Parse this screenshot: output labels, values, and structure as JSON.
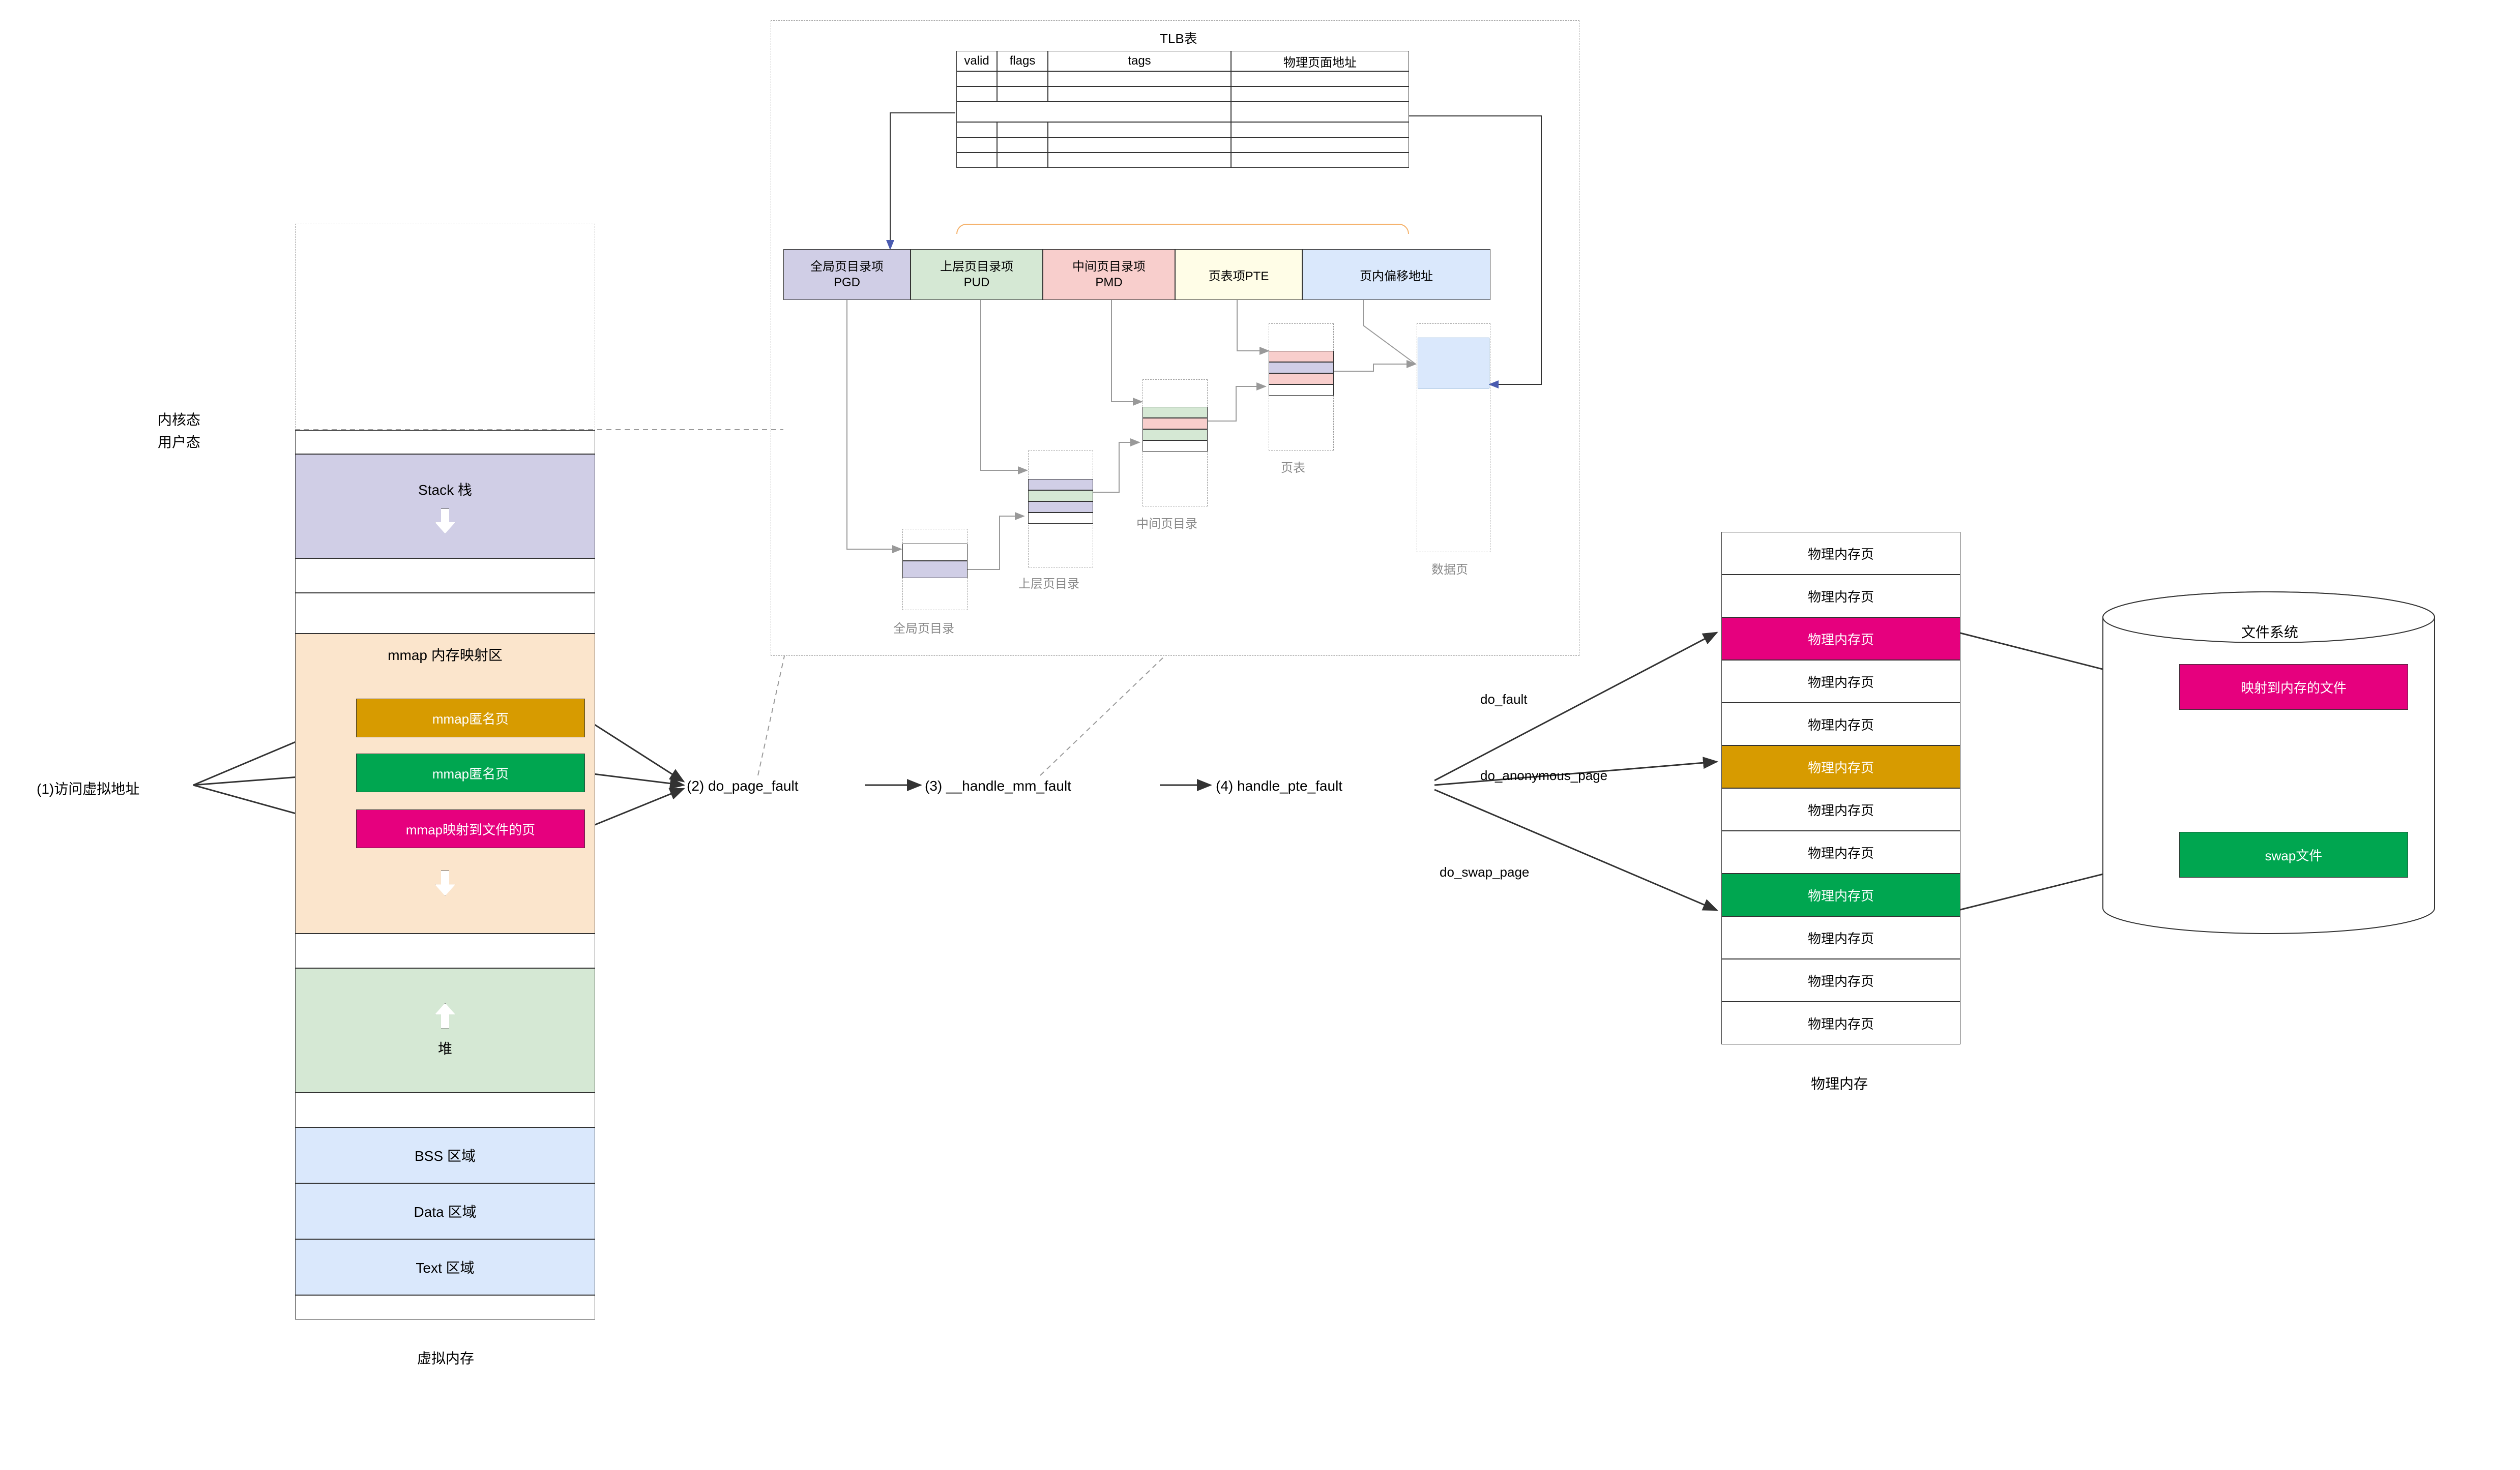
{
  "left": {
    "kernel_label": "内核态",
    "user_label": "用户态",
    "access_label": "(1)访问虚拟地址",
    "stack_label": "Stack 栈",
    "mmap_section": "mmap 内存映射区",
    "mmap_anon1": "mmap匿名页",
    "mmap_anon2": "mmap匿名页",
    "mmap_file": "mmap映射到文件的页",
    "heap_label": "堆",
    "bss_label": "BSS 区域",
    "data_label": "Data 区域",
    "text_label": "Text 区域",
    "vm_label": "虚拟内存"
  },
  "flow": {
    "step2": "(2) do_page_fault",
    "step3": "(3) __handle_mm_fault",
    "step4": "(4) handle_pte_fault",
    "do_fault": "do_fault",
    "do_anon": "do_anonymous_page",
    "do_swap": "do_swap_page"
  },
  "tlb": {
    "title": "TLB表",
    "col1": "valid",
    "col2": "flags",
    "col3": "tags",
    "col4": "物理页面地址",
    "pgd_top": "全局页目录项",
    "pgd": "PGD",
    "pud_top": "上层页目录项",
    "pud": "PUD",
    "pmd_top": "中间页目录项",
    "pmd": "PMD",
    "pte": "页表项PTE",
    "offset": "页内偏移地址",
    "pgd_label": "全局页目录",
    "pud_label": "上层页目录",
    "pmd_label": "中间页目录",
    "pt_label": "页表",
    "data_page": "数据页"
  },
  "phys": {
    "row1": "物理内存页",
    "row2": "物理内存页",
    "row3": "物理内存页",
    "row4": "物理内存页",
    "row5": "物理内存页",
    "row6": "物理内存页",
    "row7": "物理内存页",
    "row8": "物理内存页",
    "row9": "物理内存页",
    "row10": "物理内存页",
    "row11": "物理内存页",
    "row12": "物理内存页",
    "label": "物理内存"
  },
  "fs": {
    "title": "文件系统",
    "mapped": "映射到内存的文件",
    "swap": "swap文件"
  }
}
